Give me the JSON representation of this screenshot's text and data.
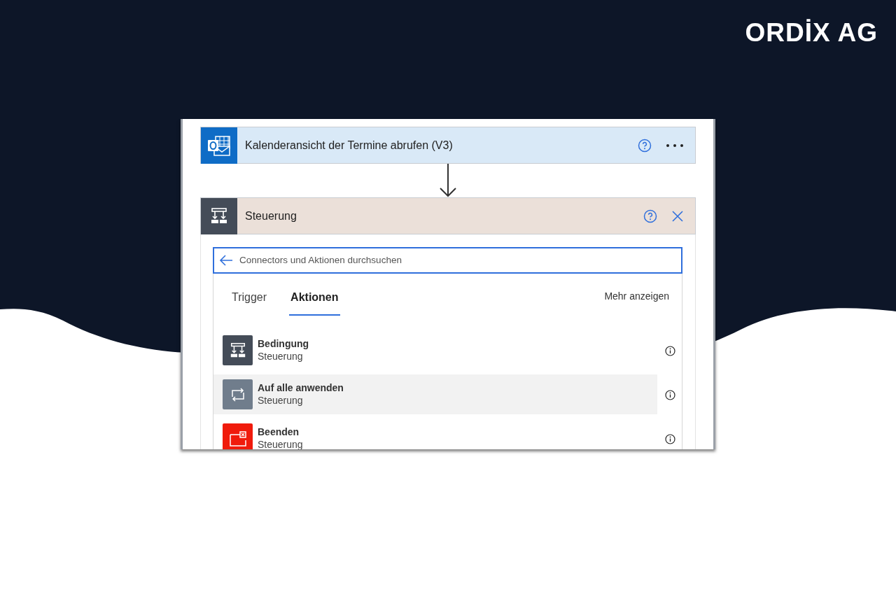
{
  "logo": {
    "text": "ORDİX AG"
  },
  "flow_steps": [
    {
      "kind": "outlook",
      "title": "Kalenderansicht der Termine abrufen (V3)",
      "more_button": true,
      "close_button": false
    },
    {
      "kind": "control",
      "title": "Steuerung",
      "more_button": false,
      "close_button": true
    }
  ],
  "search": {
    "placeholder": "Connectors und Aktionen durchsuchen"
  },
  "tabs": [
    {
      "label": "Trigger",
      "selected": false
    },
    {
      "label": "Aktionen",
      "selected": true
    }
  ],
  "more_link": "Mehr anzeigen",
  "actions": [
    {
      "kind": "condition",
      "title": "Bedingung",
      "subtitle": "Steuerung",
      "color": "#444c58",
      "selected": false
    },
    {
      "kind": "loop",
      "title": "Auf alle anwenden",
      "subtitle": "Steuerung",
      "color": "#707d8c",
      "selected": true
    },
    {
      "kind": "terminate",
      "title": "Beenden",
      "subtitle": "Steuerung",
      "color": "#f01b0c",
      "selected": false
    }
  ]
}
